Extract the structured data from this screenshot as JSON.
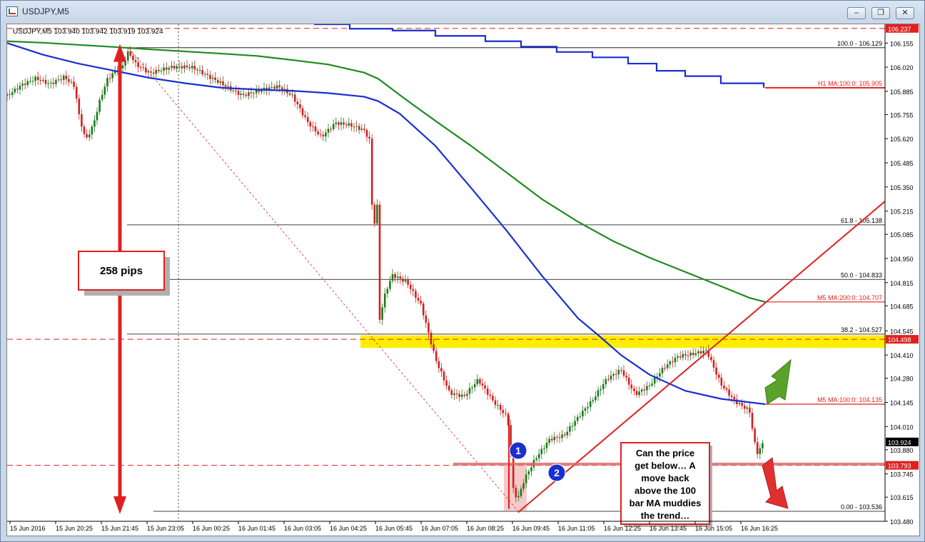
{
  "window": {
    "title": "USDJPY,M5",
    "controls": [
      "minimize",
      "restore",
      "close"
    ]
  },
  "chart_data": {
    "type": "line",
    "symbol_header": "USDJPY,M5  103.940 103.942 103.919 103.924",
    "ylim": [
      103.48,
      106.26
    ],
    "y_ticks": [
      106.155,
      106.02,
      105.885,
      105.755,
      105.62,
      105.485,
      105.35,
      105.215,
      105.085,
      104.95,
      104.815,
      104.685,
      104.545,
      104.41,
      104.28,
      104.145,
      104.01,
      103.88,
      103.745,
      103.615,
      103.48
    ],
    "y_tick_labels": [
      "106.155",
      "106.020",
      "105.885",
      "105.755",
      "105.620",
      "105.485",
      "105.350",
      "105.215",
      "105.085",
      "104.950",
      "104.815",
      "104.685",
      "104.545",
      "104.410",
      "104.280",
      "104.145",
      "104.010",
      "103.880",
      "103.745",
      "103.615",
      "103.480"
    ],
    "x_labels": [
      "15 Jun 2016",
      "15 Jun 20:25",
      "15 Jun 21:45",
      "15 Jun 23:05",
      "16 Jun 00:25",
      "16 Jun 01:45",
      "16 Jun 03:05",
      "16 Jun 04:25",
      "16 Jun 05:45",
      "16 Jun 07:05",
      "16 Jun 08:25",
      "16 Jun 09:45",
      "16 Jun 11:05",
      "16 Jun 12:25",
      "16 Jun 13:45",
      "16 Jun 15:05",
      "16 Jun 16:25"
    ],
    "x_range": [
      0,
      1230
    ],
    "series": [
      {
        "name": "M5 MA:200:0",
        "color": "#1f8a1f",
        "x": [
          0,
          50,
          100,
          150,
          200,
          250,
          300,
          350,
          400,
          450,
          500,
          520,
          560,
          600,
          650,
          700,
          750,
          800,
          850,
          900,
          950,
          1000,
          1040,
          1062
        ],
        "y": [
          106.165,
          106.157,
          106.145,
          106.133,
          106.12,
          106.108,
          106.096,
          106.083,
          106.06,
          106.035,
          105.99,
          105.955,
          105.835,
          105.72,
          105.58,
          105.43,
          105.28,
          105.155,
          105.045,
          104.955,
          104.875,
          104.795,
          104.73,
          104.707
        ]
      },
      {
        "name": "M5 MA:100:0",
        "color": "#1a2fd0",
        "x": [
          0,
          50,
          100,
          150,
          200,
          250,
          300,
          350,
          400,
          450,
          500,
          520,
          550,
          600,
          650,
          700,
          750,
          800,
          830,
          860,
          900,
          950,
          1000,
          1062
        ],
        "y": [
          106.155,
          106.09,
          106.04,
          106.0,
          105.96,
          105.93,
          105.905,
          105.895,
          105.888,
          105.875,
          105.855,
          105.83,
          105.76,
          105.58,
          105.345,
          105.105,
          104.85,
          104.615,
          104.515,
          104.41,
          104.3,
          104.21,
          104.165,
          104.135
        ]
      },
      {
        "name": "H1 MA:100:0",
        "color": "#1a2fd0",
        "x": [
          430,
          480,
          540,
          600,
          670,
          720,
          770,
          820,
          870,
          910,
          950,
          1000,
          1060
        ],
        "y": [
          106.26,
          106.235,
          106.225,
          106.195,
          106.165,
          106.135,
          106.105,
          106.075,
          106.04,
          106.0,
          105.97,
          105.93,
          105.905
        ]
      },
      {
        "name": "USDJPY close",
        "color": "#1c7a1c",
        "x": [
          0,
          20,
          40,
          60,
          80,
          95,
          100,
          110,
          120,
          130,
          140,
          150,
          160,
          170,
          180,
          200,
          230,
          260,
          300,
          330,
          360,
          380,
          400,
          420,
          440,
          460,
          480,
          500,
          508,
          510,
          514,
          518,
          522,
          530,
          540,
          560,
          580,
          600,
          620,
          640,
          660,
          680,
          700,
          704,
          708,
          715,
          725,
          740,
          760,
          780,
          800,
          820,
          840,
          860,
          880,
          900,
          920,
          940,
          960,
          980,
          1000,
          1020,
          1040,
          1050,
          1062
        ],
        "y": [
          105.86,
          105.93,
          105.97,
          105.93,
          105.96,
          105.9,
          105.75,
          105.6,
          105.68,
          105.83,
          105.95,
          106.0,
          106.02,
          106.12,
          106.05,
          105.99,
          106.01,
          106.01,
          105.94,
          105.87,
          105.89,
          105.9,
          105.85,
          105.72,
          105.64,
          105.72,
          105.7,
          105.66,
          105.6,
          105.3,
          105.1,
          105.3,
          104.6,
          104.75,
          104.85,
          104.82,
          104.7,
          104.4,
          104.2,
          104.17,
          104.26,
          104.15,
          104.07,
          103.99,
          103.68,
          103.61,
          103.73,
          103.84,
          103.94,
          103.95,
          104.05,
          104.15,
          104.28,
          104.34,
          104.2,
          104.24,
          104.33,
          104.39,
          104.41,
          104.44,
          104.26,
          104.16,
          104.1,
          103.85,
          103.924
        ]
      }
    ],
    "levels": [
      {
        "label": "100.0 - 106.129",
        "value": 106.129
      },
      {
        "label": "61.8 - 105.138",
        "value": 105.138
      },
      {
        "label": "50.0 - 104.833",
        "value": 104.833
      },
      {
        "label": "38.2 - 104.527",
        "value": 104.527
      },
      {
        "label": "0.00 - 103.536",
        "value": 103.536
      }
    ],
    "ma_labels": [
      {
        "label": "H1 MA:100:0: 105.905",
        "value": 105.905
      },
      {
        "label": "M5 MA:200:0: 104.707",
        "value": 104.707
      },
      {
        "label": "M5 MA:100:0: 104.135",
        "value": 104.135
      }
    ],
    "price_tags": [
      {
        "label": "106.237",
        "value": 106.237,
        "color": "#e02020"
      },
      {
        "label": "104.498",
        "value": 104.498,
        "color": "#e02020"
      },
      {
        "label": "103.924",
        "value": 103.924,
        "color": "#000000"
      },
      {
        "label": "103.793",
        "value": 103.793,
        "color": "#e02020"
      }
    ],
    "annotations": {
      "pips_label": "258 pips",
      "note_lines": [
        "Can the price",
        "get below… A",
        "move back",
        "above the 100",
        "bar MA muddies",
        "the trend…"
      ],
      "marker_1": "1",
      "marker_2": "2"
    },
    "colors": {
      "bull": "#1c7a1c",
      "bear": "#d02020",
      "highlight": "#ffee00",
      "ma200": "#1f8a1f",
      "ma100": "#1a2fd0",
      "annotation": "#e02020"
    }
  }
}
